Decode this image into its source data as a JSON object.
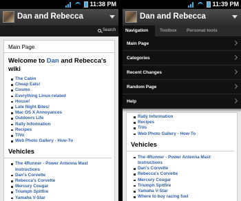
{
  "status": {
    "time": "11:38 PM",
    "time_right": "11:39 PM"
  },
  "app": {
    "title": "Dan and Rebecca"
  },
  "search": {
    "label": "Search"
  },
  "page": {
    "heading": "Main Page",
    "welcome_pre": "Welcome to ",
    "welcome_link": "Dan",
    "welcome_post": " and Rebecca's wiki",
    "links": [
      "The Cabin",
      "Cheap Eats!",
      "Cosmo",
      "Everything Linux-related",
      "House!",
      "Late Night Bites!",
      "Mac OS X Annoyances",
      "Outdoors Life",
      "Rally Information",
      "Recipes",
      "TiVo",
      "Web Photo Gallery - How-To"
    ],
    "vehicles_heading": "Vehicles",
    "vehicles": [
      "The 4Runner - Power Antenna Mast Instructions",
      "Dan's Corvette",
      "Rebecca's Corvette",
      "Mercury Cougar",
      "Triumph Spitfire",
      "Yamaha V-Star",
      "Where to buy racing fuel"
    ]
  },
  "menu": {
    "tabs": [
      "Navigation",
      "Toolbox",
      "Personal tools"
    ],
    "items": [
      "Main Page",
      "Categories",
      "Recent Changes",
      "Random Page",
      "Help"
    ]
  },
  "colors": {
    "link": "#2f5faa",
    "titlebar": "#3c3c3c",
    "menu_bg": "#111111"
  }
}
